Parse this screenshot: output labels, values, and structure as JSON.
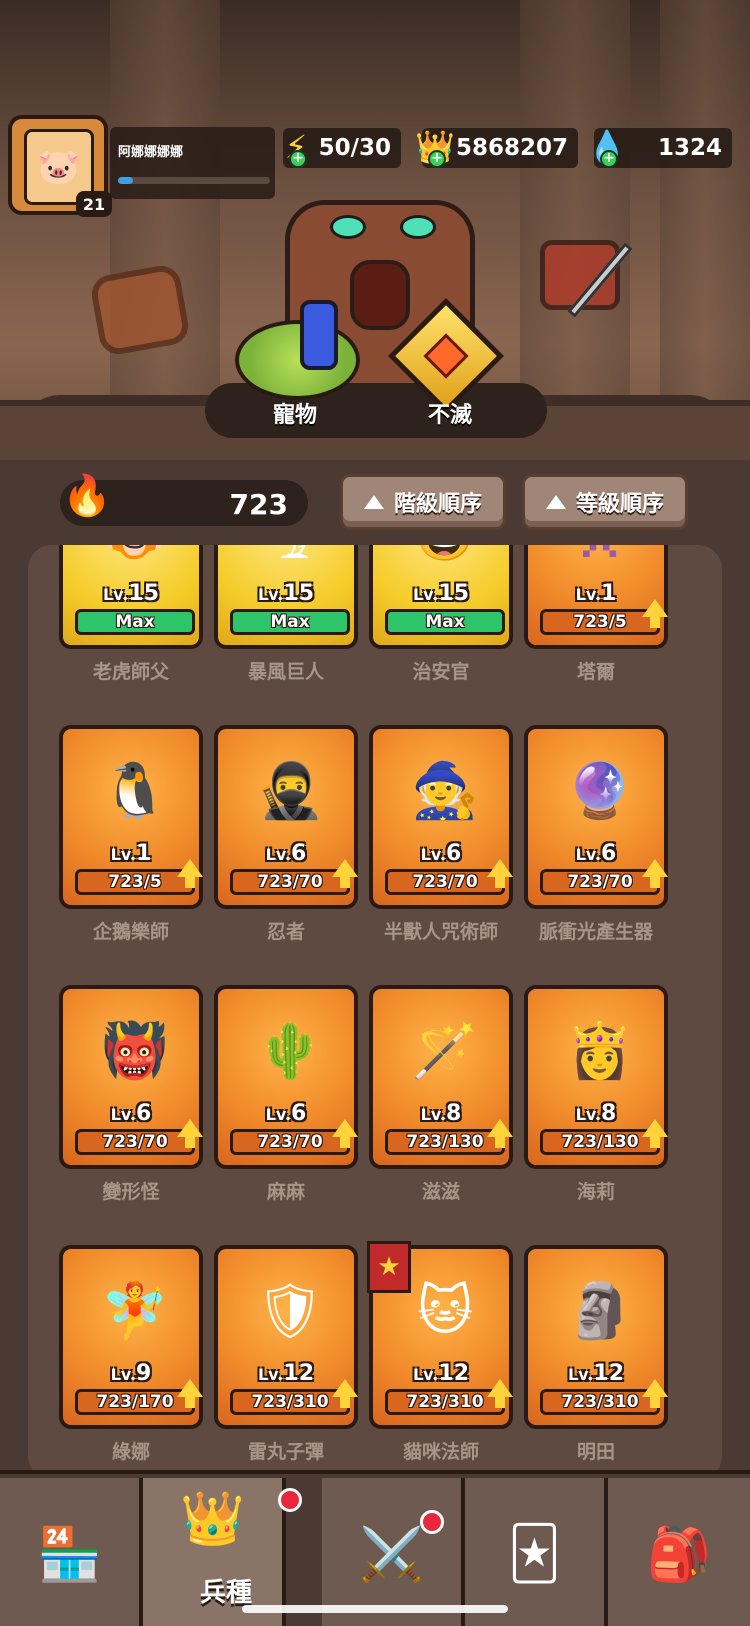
{
  "profile": {
    "name": "阿娜娜娜娜",
    "level": "21",
    "xp_fraction": 0.1
  },
  "resources": [
    {
      "icon": "lightning-icon",
      "value": "50/30"
    },
    {
      "icon": "crown-coin-icon",
      "value": "5868207"
    },
    {
      "icon": "gem-icon",
      "value": "1324"
    }
  ],
  "menu": {
    "pet_label": "寵物",
    "immortal_label": "不滅"
  },
  "power": {
    "value": "723"
  },
  "sort": {
    "rank_label": "階級順序",
    "level_label": "等級順序"
  },
  "units": [
    {
      "name": "老虎師父",
      "level": "15",
      "progress": "Max",
      "maxed": true,
      "glyph": "🐯"
    },
    {
      "name": "暴風巨人",
      "level": "15",
      "progress": "Max",
      "maxed": true,
      "glyph": "🌪"
    },
    {
      "name": "治安官",
      "level": "15",
      "progress": "Max",
      "maxed": true,
      "glyph": "🤠"
    },
    {
      "name": "塔爾",
      "level": "1",
      "progress": "723/5",
      "maxed": false,
      "glyph": "👾"
    },
    {
      "name": "企鵝樂師",
      "level": "1",
      "progress": "723/5",
      "maxed": false,
      "glyph": "🐧"
    },
    {
      "name": "忍者",
      "level": "6",
      "progress": "723/70",
      "maxed": false,
      "glyph": "🥷"
    },
    {
      "name": "半獸人咒術師",
      "level": "6",
      "progress": "723/70",
      "maxed": false,
      "glyph": "🧙"
    },
    {
      "name": "脈衝光產生器",
      "level": "6",
      "progress": "723/70",
      "maxed": false,
      "glyph": "🔮"
    },
    {
      "name": "變形怪",
      "level": "6",
      "progress": "723/70",
      "maxed": false,
      "glyph": "👹"
    },
    {
      "name": "麻麻",
      "level": "6",
      "progress": "723/70",
      "maxed": false,
      "glyph": "🌵"
    },
    {
      "name": "滋滋",
      "level": "8",
      "progress": "723/130",
      "maxed": false,
      "glyph": "🪄"
    },
    {
      "name": "海莉",
      "level": "8",
      "progress": "723/130",
      "maxed": false,
      "glyph": "👸"
    },
    {
      "name": "綠娜",
      "level": "9",
      "progress": "723/170",
      "maxed": false,
      "glyph": "🧚"
    },
    {
      "name": "雷丸子彈",
      "level": "12",
      "progress": "723/310",
      "maxed": false,
      "glyph": "🛡"
    },
    {
      "name": "貓咪法師",
      "level": "12",
      "progress": "723/310",
      "maxed": false,
      "glyph": "🐱"
    },
    {
      "name": "明田",
      "level": "12",
      "progress": "723/310",
      "maxed": false,
      "glyph": "🗿"
    }
  ],
  "lv_prefix": "Lv.",
  "nav": {
    "active_label": "兵種"
  },
  "colors": {
    "card_orange": "#f08a2a",
    "card_gold": "#f5cc2a",
    "max_bar": "#2ec46a",
    "progress_bar": "#d8661e"
  }
}
